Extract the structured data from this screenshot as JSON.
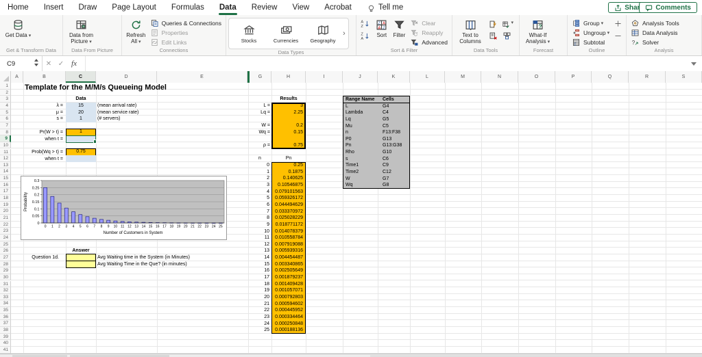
{
  "menubar": {
    "items": [
      {
        "label": "Home"
      },
      {
        "label": "Insert"
      },
      {
        "label": "Draw"
      },
      {
        "label": "Page Layout"
      },
      {
        "label": "Formulas"
      },
      {
        "label": "Data",
        "active": true
      },
      {
        "label": "Review"
      },
      {
        "label": "View"
      },
      {
        "label": "Acrobat"
      },
      {
        "label": "Tell me",
        "icon": "bulb"
      }
    ],
    "share_label": "Share",
    "comments_label": "Comments"
  },
  "ribbon": {
    "dropdown_glyph": "▾",
    "groups": [
      {
        "label": "Get & Transform Data",
        "buttons": [
          {
            "kind": "big",
            "label": "Get Data",
            "icon": "database-icon",
            "dropdown": true
          }
        ]
      },
      {
        "label": "Data From Picture",
        "buttons": [
          {
            "kind": "big",
            "label": "Data from Picture",
            "icon": "table-camera-icon",
            "dropdown": true
          }
        ]
      },
      {
        "label": "Connections",
        "buttons": [
          {
            "kind": "big",
            "label": "Refresh All",
            "icon": "refresh-icon",
            "dropdown": true
          },
          {
            "kind": "stack",
            "items": [
              {
                "label": "Queries & Connections",
                "icon": "queries-connections-icon"
              },
              {
                "label": "Properties",
                "icon": "properties-icon",
                "disabled": true
              },
              {
                "label": "Edit Links",
                "icon": "edit-links-icon",
                "disabled": true
              }
            ]
          }
        ]
      },
      {
        "label": "Data Types",
        "buttons": [
          {
            "kind": "gallery",
            "more_label": "›",
            "items": [
              {
                "label": "Stocks",
                "icon": "bank-icon"
              },
              {
                "label": "Currencies",
                "icon": "currencies-icon"
              },
              {
                "label": "Geography",
                "icon": "map-icon"
              }
            ]
          }
        ]
      },
      {
        "label": "Sort & Filter",
        "buttons": [
          {
            "kind": "smallstack",
            "items": [
              {
                "icon": "sort-asc-icon"
              },
              {
                "icon": "sort-desc-icon"
              }
            ]
          },
          {
            "kind": "big",
            "label": "Sort",
            "icon": "sort-dialog-icon"
          },
          {
            "kind": "big",
            "label": "Filter",
            "icon": "filter-funnel-icon"
          },
          {
            "kind": "stack",
            "items": [
              {
                "label": "Clear",
                "icon": "clear-filter-icon",
                "disabled": true
              },
              {
                "label": "Reapply",
                "icon": "reapply-filter-icon",
                "disabled": true
              },
              {
                "label": "Advanced",
                "icon": "advanced-filter-icon"
              }
            ]
          }
        ]
      },
      {
        "label": "Data Tools",
        "buttons": [
          {
            "kind": "big",
            "label": "Text to Columns",
            "icon": "text-to-columns-icon"
          },
          {
            "kind": "grid2",
            "items": [
              {
                "icon": "flash-fill-icon"
              },
              {
                "icon": "data-validation-icon",
                "dropdown": true
              },
              {
                "icon": "remove-duplicates-icon"
              },
              {
                "icon": "consolidate-icon"
              }
            ]
          }
        ]
      },
      {
        "label": "Forecast",
        "buttons": [
          {
            "kind": "big",
            "label": "What-If Analysis",
            "icon": "what-if-icon",
            "dropdown": true
          }
        ]
      },
      {
        "label": "Outline",
        "buttons": [
          {
            "kind": "stack",
            "items": [
              {
                "label": "Group",
                "icon": "group-icon",
                "dropdown": true
              },
              {
                "label": "Ungroup",
                "icon": "ungroup-icon",
                "dropdown": true
              },
              {
                "label": "Subtotal",
                "icon": "subtotal-icon"
              }
            ]
          },
          {
            "kind": "smallstack",
            "items": [
              {
                "icon": "show-detail-icon"
              },
              {
                "icon": "hide-detail-icon"
              }
            ]
          }
        ]
      },
      {
        "label": "Analysis",
        "buttons": [
          {
            "kind": "stack",
            "items": [
              {
                "label": "Analysis Tools",
                "icon": "analysis-tools-icon"
              },
              {
                "label": "Data Analysis",
                "icon": "data-analysis-icon"
              },
              {
                "label": "Solver",
                "icon": "solver-icon"
              }
            ]
          }
        ]
      }
    ]
  },
  "formula_bar": {
    "name_box": "C9",
    "cancel_glyph": "✕",
    "enter_glyph": "✓",
    "fx_label": "fx"
  },
  "sheet": {
    "columns": [
      "A",
      "B",
      "C",
      "D",
      "E",
      "G",
      "H",
      "I",
      "J",
      "K",
      "L",
      "M",
      "N",
      "O",
      "P",
      "Q",
      "R",
      "S"
    ],
    "hidden_column_after": "E",
    "visible_rows": 41,
    "selected_cell": "C9",
    "selected_column": "C",
    "selected_row": 9,
    "title": "Template for the M/M/s Queueing Model",
    "data_block": {
      "header": "Data",
      "rows": [
        {
          "label": "λ =",
          "value": "15",
          "note": "(mean arrival rate)"
        },
        {
          "label": "μ =",
          "value": "20",
          "note": "(mean service rate)"
        },
        {
          "label": "s =",
          "value": "1",
          "note": "(# servers)"
        }
      ]
    },
    "prob_block": {
      "rows": [
        {
          "label": "Pr(W > t) =",
          "value": "1"
        },
        {
          "label": "when t =",
          "value": ""
        },
        {
          "label": "Prob(Wq > t) =",
          "value": "0.75"
        },
        {
          "label": "when t =",
          "value": ""
        }
      ]
    },
    "results": {
      "header": "Results",
      "rows": [
        {
          "label": "L =",
          "value": "3"
        },
        {
          "label": "Lq =",
          "value": "2.25"
        },
        {
          "label": "W =",
          "value": "0.2"
        },
        {
          "label": "Wq =",
          "value": "0.15"
        },
        {
          "label": "ρ =",
          "value": "0.75"
        }
      ]
    },
    "pn_table": {
      "col_n": "n",
      "col_p": "Pn",
      "rows": [
        {
          "n": "0",
          "p": "0.25"
        },
        {
          "n": "1",
          "p": "0.1875"
        },
        {
          "n": "2",
          "p": "0.140625"
        },
        {
          "n": "3",
          "p": "0.10546875"
        },
        {
          "n": "4",
          "p": "0.079101563"
        },
        {
          "n": "5",
          "p": "0.059326172"
        },
        {
          "n": "6",
          "p": "0.044494629"
        },
        {
          "n": "7",
          "p": "0.033370972"
        },
        {
          "n": "8",
          "p": "0.025028229"
        },
        {
          "n": "9",
          "p": "0.018771172"
        },
        {
          "n": "10",
          "p": "0.014078379"
        },
        {
          "n": "11",
          "p": "0.010558784"
        },
        {
          "n": "12",
          "p": "0.007919088"
        },
        {
          "n": "13",
          "p": "0.005939316"
        },
        {
          "n": "14",
          "p": "0.004454487"
        },
        {
          "n": "15",
          "p": "0.003340865"
        },
        {
          "n": "16",
          "p": "0.002505649"
        },
        {
          "n": "17",
          "p": "0.001879237"
        },
        {
          "n": "18",
          "p": "0.001409428"
        },
        {
          "n": "19",
          "p": "0.001057071"
        },
        {
          "n": "20",
          "p": "0.000792803"
        },
        {
          "n": "21",
          "p": "0.000594602"
        },
        {
          "n": "22",
          "p": "0.000445952"
        },
        {
          "n": "23",
          "p": "0.000334464"
        },
        {
          "n": "24",
          "p": "0.000250848"
        },
        {
          "n": "25",
          "p": "0.000188136"
        }
      ]
    },
    "range_table": {
      "headers": [
        "Range Name",
        "Cells"
      ],
      "rows": [
        [
          "L",
          "G4"
        ],
        [
          "Lambda",
          "C4"
        ],
        [
          "Lq",
          "G5"
        ],
        [
          "Mu",
          "C5"
        ],
        [
          "n",
          "F13:F38"
        ],
        [
          "P0",
          "G13"
        ],
        [
          "Pn",
          "G13:G38"
        ],
        [
          "Rho",
          "G10"
        ],
        [
          "s",
          "C6"
        ],
        [
          "Time1",
          "C9"
        ],
        [
          "Time2",
          "C12"
        ],
        [
          "W",
          "G7"
        ],
        [
          "Wq",
          "G8"
        ]
      ]
    },
    "answer_block": {
      "header": "Answer",
      "question_label": "Question  1d.",
      "rows": [
        {
          "note": "Avg Waiting time in the System (in Minutes)"
        },
        {
          "note": "Avg Waiting Time in the Que? (in minutes)"
        }
      ]
    }
  },
  "chart_data": {
    "type": "bar",
    "x": [
      0,
      1,
      2,
      3,
      4,
      5,
      6,
      7,
      8,
      9,
      10,
      11,
      12,
      13,
      14,
      15,
      16,
      17,
      18,
      19,
      20,
      21,
      22,
      23,
      24,
      25
    ],
    "values": [
      0.25,
      0.1875,
      0.140625,
      0.10546875,
      0.079101563,
      0.059326172,
      0.044494629,
      0.033370972,
      0.025028229,
      0.018771172,
      0.014078379,
      0.010558784,
      0.007919088,
      0.005939316,
      0.004454487,
      0.003340865,
      0.002505649,
      0.001879237,
      0.001409428,
      0.001057071,
      0.000792803,
      0.000594602,
      0.000445952,
      0.000334464,
      0.000250848,
      0.000188136
    ],
    "title": "",
    "xlabel": "Number of Customers in System",
    "ylabel": "Probability",
    "ylim": [
      0,
      0.3
    ],
    "yticks": [
      "0",
      "0.05",
      "0.1",
      "0.15",
      "0.2",
      "0.25",
      "0.3"
    ],
    "grid": true,
    "legend": false,
    "plot_bg": "#C0C0C0",
    "bar_color": "#9999FF",
    "bar_border": "#26267F"
  }
}
